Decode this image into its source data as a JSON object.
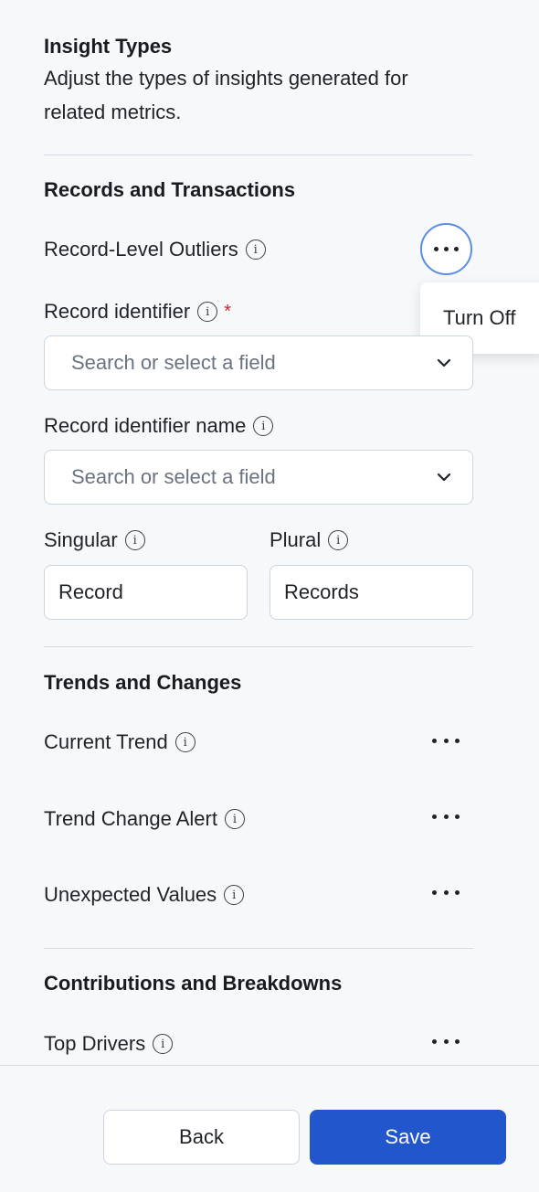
{
  "header": {
    "title": "Insight Types",
    "description_line1": "Adjust the types of insights generated for",
    "description_line2": "related metrics."
  },
  "records_section": {
    "title": "Records and Transactions",
    "outliers_label": "Record-Level Outliers",
    "menu_popup_item": "Turn Off",
    "record_identifier_label": "Record identifier",
    "required_mark": "*",
    "record_identifier_placeholder": "Search or select a field",
    "record_identifier_name_label": "Record identifier name",
    "record_identifier_name_placeholder": "Search or select a field",
    "singular_label": "Singular",
    "singular_value": "Record",
    "plural_label": "Plural",
    "plural_value": "Records"
  },
  "trends_section": {
    "title": "Trends and Changes",
    "items": [
      {
        "label": "Current Trend"
      },
      {
        "label": "Trend Change Alert"
      },
      {
        "label": "Unexpected Values"
      }
    ]
  },
  "contributions_section": {
    "title": "Contributions and Breakdowns",
    "items": [
      {
        "label": "Top Drivers"
      }
    ]
  },
  "footer": {
    "back_label": "Back",
    "save_label": "Save"
  },
  "icons": {
    "info": "info-icon",
    "more": "more-horizontal-icon",
    "chevron": "chevron-down-icon"
  },
  "colors": {
    "primary": "#2156cc",
    "required": "#c62828",
    "focus_ring": "#5a8ee6"
  }
}
